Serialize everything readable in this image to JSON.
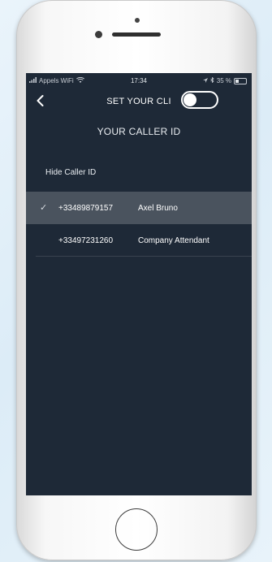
{
  "status_bar": {
    "carrier": "Appels WiFi",
    "time": "17:34",
    "battery": "35 %"
  },
  "nav": {
    "title": "SET YOUR CLI"
  },
  "section": {
    "title": "YOUR CALLER ID"
  },
  "hide_caller_id": {
    "label": "Hide Caller ID",
    "enabled": false
  },
  "caller_ids": [
    {
      "check": "✓",
      "number": "+33489879157",
      "name": "Axel Bruno",
      "selected": true
    },
    {
      "check": "",
      "number": "+33497231260",
      "name": "Company Attendant",
      "selected": false
    }
  ],
  "colors": {
    "screen_bg": "#1e2937",
    "selected_row": "#4a535e",
    "text": "#ffffff"
  }
}
